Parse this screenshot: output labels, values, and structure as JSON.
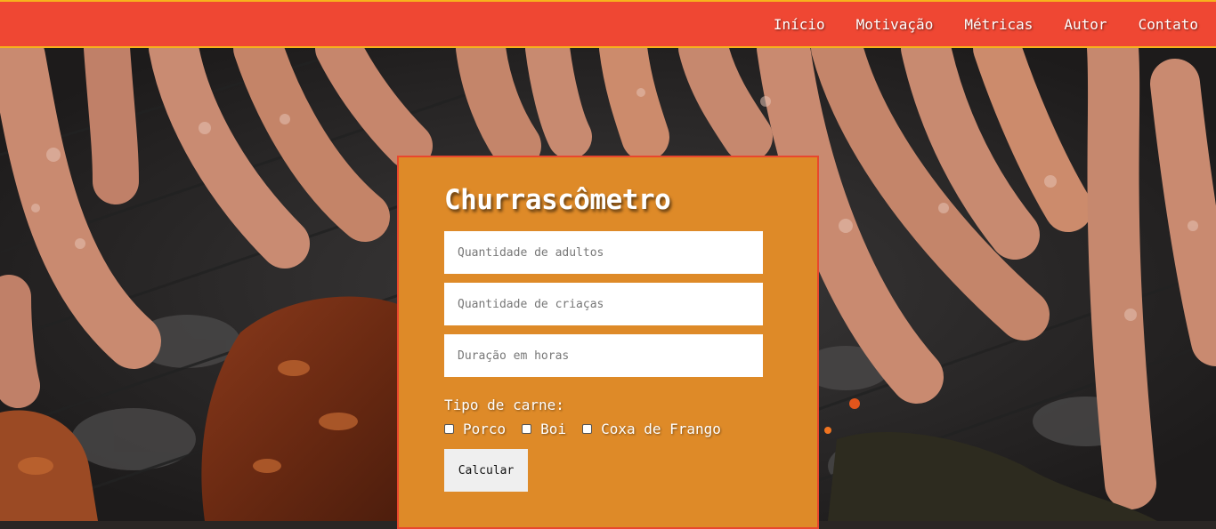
{
  "nav": {
    "links": [
      "Início",
      "Motivação",
      "Métricas",
      "Autor",
      "Contato"
    ]
  },
  "hero": {
    "image": "grilled-sausages-and-meat-photo"
  },
  "calculator": {
    "title": "Churrascômetro",
    "adults_placeholder": "Quantidade de adultos",
    "children_placeholder": "Quantidade de criaças",
    "hours_placeholder": "Duração em horas",
    "meat_label": "Tipo de carne:",
    "meat_options": [
      "Porco",
      "Boi",
      "Coxa de Frango"
    ],
    "button_label": "Calcular"
  },
  "colors": {
    "nav_bg": "#ef4733",
    "nav_border": "#f7b21d",
    "card_bg": "#de8a28",
    "card_border": "#e8472e"
  }
}
